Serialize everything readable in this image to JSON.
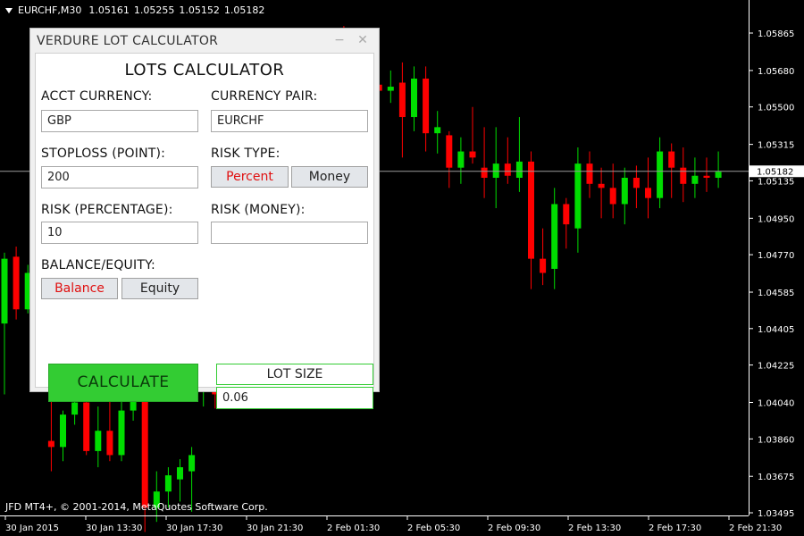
{
  "chart": {
    "symbol": "EURCHF,M30",
    "quotes": [
      "1.05161",
      "1.05255",
      "1.05152",
      "1.05182"
    ],
    "copyright": "JFD MT4+, © 2001-2014, MetaQuotes Software Corp.",
    "current_price": "1.05182",
    "colors": {
      "bull": "#00dd00",
      "bear": "#ff0000",
      "background": "#000000",
      "axis": "#ffffff"
    }
  },
  "chart_data": {
    "type": "candlestick",
    "title": "EURCHF,M30",
    "y_ticks": [
      "1.05865",
      "1.05680",
      "1.05500",
      "1.05315",
      "1.05135",
      "1.04950",
      "1.04770",
      "1.04585",
      "1.04405",
      "1.04225",
      "1.04040",
      "1.03860",
      "1.03675",
      "1.03495"
    ],
    "x_ticks": [
      "30 Jan 2015",
      "30 Jan 13:30",
      "30 Jan 17:30",
      "30 Jan 21:30",
      "2 Feb 01:30",
      "2 Feb 05:30",
      "2 Feb 09:30",
      "2 Feb 13:30",
      "2 Feb 17:30",
      "2 Feb 21:30"
    ],
    "ylim": [
      1.03495,
      1.05865
    ],
    "current_price": 1.05182,
    "candles": [
      [
        1.0443,
        1.0478,
        1.0408,
        1.0475
      ],
      [
        1.0476,
        1.0481,
        1.0445,
        1.045
      ],
      [
        1.045,
        1.0472,
        1.0448,
        1.0468
      ],
      [
        1.0465,
        1.047,
        1.045,
        1.0452
      ],
      [
        1.0385,
        1.0415,
        1.037,
        1.0382
      ],
      [
        1.0382,
        1.04,
        1.0375,
        1.0398
      ],
      [
        1.0398,
        1.0408,
        1.0393,
        1.0404
      ],
      [
        1.0404,
        1.0413,
        1.0378,
        1.038
      ],
      [
        1.038,
        1.0402,
        1.0372,
        1.039
      ],
      [
        1.039,
        1.041,
        1.0375,
        1.0378
      ],
      [
        1.0378,
        1.0405,
        1.0375,
        1.04
      ],
      [
        1.04,
        1.042,
        1.0395,
        1.0412
      ],
      [
        1.0415,
        1.0425,
        1.034,
        1.0352
      ],
      [
        1.0352,
        1.037,
        1.0345,
        1.036
      ],
      [
        1.036,
        1.0372,
        1.0352,
        1.0368
      ],
      [
        1.0366,
        1.0376,
        1.0355,
        1.0372
      ],
      [
        1.037,
        1.0382,
        1.035,
        1.0378
      ],
      [
        1.0415,
        1.0425,
        1.0402,
        1.042
      ],
      [
        1.042,
        1.0428,
        1.0401,
        1.0408
      ],
      [
        1.046,
        1.0468,
        1.045,
        1.0455
      ],
      [
        1.0455,
        1.0465,
        1.0452,
        1.0462
      ],
      [
        1.0462,
        1.047,
        1.0455,
        1.0466
      ],
      [
        1.0458,
        1.048,
        1.045,
        1.0475
      ],
      [
        1.0478,
        1.0485,
        1.0465,
        1.047
      ],
      [
        1.047,
        1.049,
        1.0452,
        1.0485
      ],
      [
        1.0485,
        1.0495,
        1.047,
        1.049
      ],
      [
        1.049,
        1.0502,
        1.0482,
        1.05
      ],
      [
        1.05,
        1.0525,
        1.0495,
        1.052
      ],
      [
        1.052,
        1.0582,
        1.0512,
        1.0568
      ],
      [
        1.0568,
        1.059,
        1.0548,
        1.0552
      ],
      [
        1.0552,
        1.0558,
        1.0532,
        1.054
      ],
      [
        1.054,
        1.0566,
        1.0536,
        1.0561
      ],
      [
        1.0561,
        1.0567,
        1.0526,
        1.0558
      ],
      [
        1.0558,
        1.0568,
        1.0552,
        1.056
      ],
      [
        1.0562,
        1.0572,
        1.0525,
        1.0545
      ],
      [
        1.0545,
        1.057,
        1.0538,
        1.0564
      ],
      [
        1.0564,
        1.057,
        1.0528,
        1.0537
      ],
      [
        1.0537,
        1.0548,
        1.0527,
        1.054
      ],
      [
        1.0536,
        1.0538,
        1.051,
        1.052
      ],
      [
        1.052,
        1.0535,
        1.0512,
        1.0528
      ],
      [
        1.0528,
        1.055,
        1.0522,
        1.0525
      ],
      [
        1.052,
        1.054,
        1.0505,
        1.0515
      ],
      [
        1.0515,
        1.054,
        1.05,
        1.0522
      ],
      [
        1.0522,
        1.0535,
        1.0512,
        1.0516
      ],
      [
        1.0515,
        1.0545,
        1.0508,
        1.0523
      ],
      [
        1.0523,
        1.0528,
        1.046,
        1.0475
      ],
      [
        1.0475,
        1.049,
        1.0462,
        1.0468
      ],
      [
        1.047,
        1.051,
        1.046,
        1.0502
      ],
      [
        1.0502,
        1.0505,
        1.048,
        1.0492
      ],
      [
        1.049,
        1.053,
        1.0478,
        1.0522
      ],
      [
        1.0522,
        1.0528,
        1.0505,
        1.0512
      ],
      [
        1.0512,
        1.052,
        1.0495,
        1.051
      ],
      [
        1.051,
        1.0522,
        1.0495,
        1.0502
      ],
      [
        1.0502,
        1.052,
        1.0492,
        1.0515
      ],
      [
        1.0515,
        1.0521,
        1.05,
        1.051
      ],
      [
        1.051,
        1.0525,
        1.0495,
        1.0505
      ],
      [
        1.0505,
        1.0535,
        1.05,
        1.0528
      ],
      [
        1.0528,
        1.0532,
        1.0505,
        1.052
      ],
      [
        1.052,
        1.053,
        1.0503,
        1.0512
      ],
      [
        1.0512,
        1.0525,
        1.0505,
        1.0516
      ],
      [
        1.0516,
        1.0525,
        1.0508,
        1.0515
      ],
      [
        1.0515,
        1.0528,
        1.051,
        1.0518
      ]
    ]
  },
  "panel": {
    "window_title": "VERDURE LOT CALCULATOR",
    "minimize_icon": "−",
    "close_icon": "✕",
    "heading": "LOTS CALCULATOR",
    "acct_currency_label": "ACCT CURRENCY:",
    "acct_currency_value": "GBP",
    "currency_pair_label": "CURRENCY PAIR:",
    "currency_pair_value": "EURCHF",
    "stoploss_label": "STOPLOSS (POINT):",
    "stoploss_value": "200",
    "risk_type_label": "RISK TYPE:",
    "risk_type_options": [
      "Percent",
      "Money"
    ],
    "risk_percentage_label": "RISK (PERCENTAGE):",
    "risk_percentage_value": "10",
    "risk_money_label": "RISK (MONEY):",
    "risk_money_value": "",
    "balance_equity_label": "BALANCE/EQUITY:",
    "balance_equity_options": [
      "Balance",
      "Equity"
    ],
    "calculate_label": "CALCULATE",
    "lot_size_label": "LOT SIZE",
    "lot_size_value": "0.06",
    "selected_color": "#e01010",
    "calculate_color": "#33cc33"
  }
}
